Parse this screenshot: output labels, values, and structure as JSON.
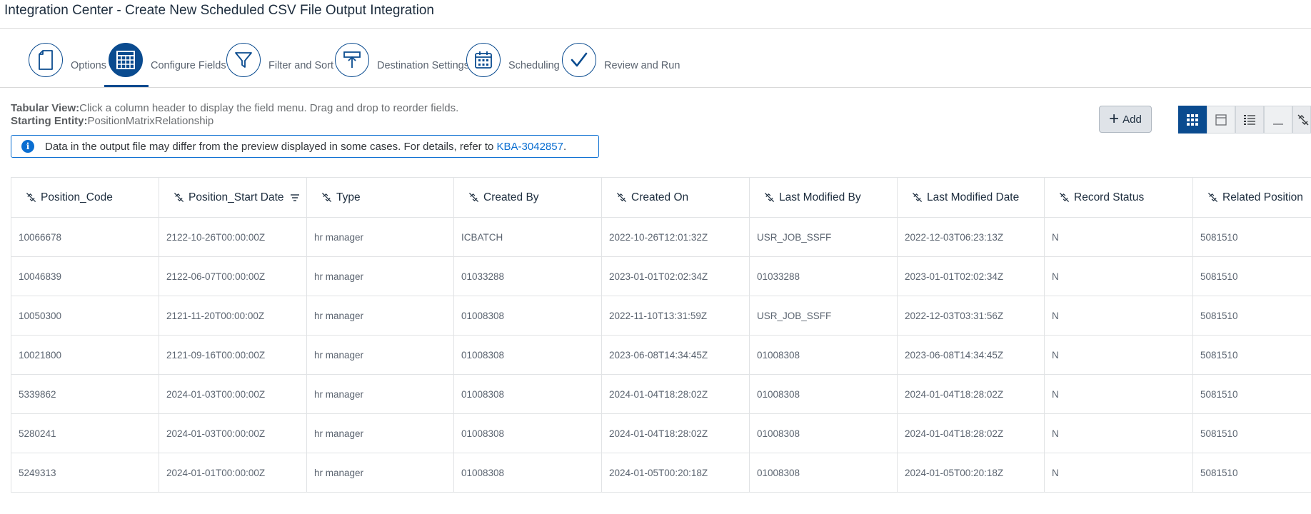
{
  "page": {
    "title": "Integration Center - Create New Scheduled CSV File Output Integration"
  },
  "wizard": {
    "steps": [
      {
        "label": "Options",
        "icon": "document-icon",
        "active": false
      },
      {
        "label": "Configure Fields",
        "icon": "table-grid-icon",
        "active": true
      },
      {
        "label": "Filter and Sort",
        "icon": "funnel-icon",
        "active": false
      },
      {
        "label": "Destination Settings",
        "icon": "upload-tray-icon",
        "active": false
      },
      {
        "label": "Scheduling",
        "icon": "calendar-icon",
        "active": false
      },
      {
        "label": "Review and Run",
        "icon": "checkmark-icon",
        "active": false
      }
    ]
  },
  "description": {
    "view_label": "Tabular View:",
    "view_text": "Click a column header to display the field menu. Drag and drop to reorder fields.",
    "entity_label": "Starting Entity:",
    "entity_text": "PositionMatrixRelationship"
  },
  "info_strip": {
    "icon": "info-icon",
    "text": "Data in the output file may differ from the preview displayed in some cases. For details, refer to ",
    "link": "KBA-3042857",
    "suffix": "."
  },
  "toolbar": {
    "add_label": "Add",
    "view_buttons": [
      "grid-view-icon",
      "card-view-icon",
      "list-view-icon",
      "minimize-icon",
      "unlink-icon"
    ]
  },
  "table": {
    "columns": [
      "Position_Code",
      "Position_Start Date",
      "Type",
      "Created By",
      "Created On",
      "Last Modified By",
      "Last Modified Date",
      "Record Status",
      "Related Position"
    ],
    "sorted_column": "Position_Start Date",
    "rows": [
      [
        "10066678",
        "2122-10-26T00:00:00Z",
        "hr manager",
        "ICBATCH",
        "2022-10-26T12:01:32Z",
        "USR_JOB_SSFF",
        "2022-12-03T06:23:13Z",
        "N",
        "5081510"
      ],
      [
        "10046839",
        "2122-06-07T00:00:00Z",
        "hr manager",
        "01033288",
        "2023-01-01T02:02:34Z",
        "01033288",
        "2023-01-01T02:02:34Z",
        "N",
        "5081510"
      ],
      [
        "10050300",
        "2121-11-20T00:00:00Z",
        "hr manager",
        "01008308",
        "2022-11-10T13:31:59Z",
        "USR_JOB_SSFF",
        "2022-12-03T03:31:56Z",
        "N",
        "5081510"
      ],
      [
        "10021800",
        "2121-09-16T00:00:00Z",
        "hr manager",
        "01008308",
        "2023-06-08T14:34:45Z",
        "01008308",
        "2023-06-08T14:34:45Z",
        "N",
        "5081510"
      ],
      [
        "5339862",
        "2024-01-03T00:00:00Z",
        "hr manager",
        "01008308",
        "2024-01-04T18:28:02Z",
        "01008308",
        "2024-01-04T18:28:02Z",
        "N",
        "5081510"
      ],
      [
        "5280241",
        "2024-01-03T00:00:00Z",
        "hr manager",
        "01008308",
        "2024-01-04T18:28:02Z",
        "01008308",
        "2024-01-04T18:28:02Z",
        "N",
        "5081510"
      ],
      [
        "5249313",
        "2024-01-01T00:00:00Z",
        "hr manager",
        "01008308",
        "2024-01-05T00:20:18Z",
        "01008308",
        "2024-01-05T00:20:18Z",
        "N",
        "5081510"
      ]
    ]
  },
  "colors": {
    "accent": "#0a4b8f",
    "link": "#0a6ed1"
  }
}
